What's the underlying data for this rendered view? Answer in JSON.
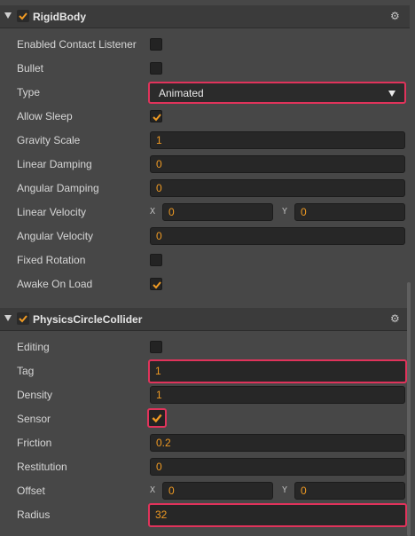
{
  "rigidbody": {
    "title": "RigidBody",
    "enabled": true,
    "enabled_contact_listener_label": "Enabled Contact Listener",
    "bullet_label": "Bullet",
    "type_label": "Type",
    "type_value": "Animated",
    "allow_sleep_label": "Allow Sleep",
    "gravity_scale_label": "Gravity Scale",
    "gravity_scale_value": "1",
    "linear_damping_label": "Linear Damping",
    "linear_damping_value": "0",
    "angular_damping_label": "Angular Damping",
    "angular_damping_value": "0",
    "linear_velocity_label": "Linear Velocity",
    "linear_velocity_x_axis": "X",
    "linear_velocity_x": "0",
    "linear_velocity_y_axis": "Y",
    "linear_velocity_y": "0",
    "angular_velocity_label": "Angular Velocity",
    "angular_velocity_value": "0",
    "fixed_rotation_label": "Fixed Rotation",
    "awake_on_load_label": "Awake On Load"
  },
  "collider": {
    "title": "PhysicsCircleCollider",
    "enabled": true,
    "editing_label": "Editing",
    "tag_label": "Tag",
    "tag_value": "1",
    "density_label": "Density",
    "density_value": "1",
    "sensor_label": "Sensor",
    "friction_label": "Friction",
    "friction_value": "0.2",
    "restitution_label": "Restitution",
    "restitution_value": "0",
    "offset_label": "Offset",
    "offset_x_axis": "X",
    "offset_x": "0",
    "offset_y_axis": "Y",
    "offset_y": "0",
    "radius_label": "Radius",
    "radius_value": "32"
  },
  "icons": {
    "expand": "chevron-down-icon",
    "settings": "gear-icon",
    "check": "checkmark-icon"
  },
  "colors": {
    "accent": "#ef9a23",
    "highlight": "#e0335b",
    "panel": "#474747",
    "header": "#3b3b3b"
  }
}
